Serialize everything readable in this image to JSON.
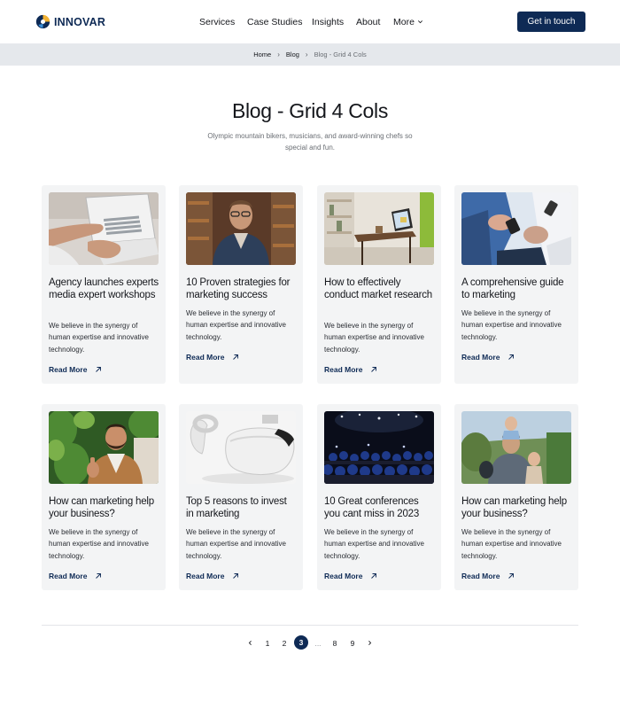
{
  "brand": {
    "name": "INNOVAR"
  },
  "nav": {
    "items": [
      "Services",
      "Case Studies",
      "Insights",
      "About"
    ],
    "more_label": "More"
  },
  "header": {
    "cta_label": "Get in touch"
  },
  "breadcrumb": {
    "home": "Home",
    "blog": "Blog",
    "current": "Blog - Grid 4 Cols"
  },
  "page": {
    "title": "Blog - Grid 4 Cols",
    "subtitle": "Olympic mountain bikers, musicians, and award-winning chefs so special and fun."
  },
  "posts": [
    {
      "title": "Agency launches experts media expert workshops",
      "excerpt": "We believe in the synergy of human expertise and innovative technology.",
      "link": "Read More",
      "image": "laptop-typing"
    },
    {
      "title": "10 Proven strategies for marketing success",
      "excerpt": "We believe in the synergy of human expertise and innovative technology.",
      "link": "Read More",
      "image": "man-with-glasses"
    },
    {
      "title": "How to effectively conduct market research",
      "excerpt": "We believe in the synergy of human expertise and innovative technology.",
      "link": "Read More",
      "image": "desk-with-laptop"
    },
    {
      "title": "A comprehensive guide to marketing",
      "excerpt": "We believe in the synergy of human expertise and innovative technology.",
      "link": "Read More",
      "image": "handshake-phones"
    },
    {
      "title": "How can marketing help your business?",
      "excerpt": "We believe in the synergy of human expertise and innovative technology.",
      "link": "Read More",
      "image": "bearded-man-thumbs-up"
    },
    {
      "title": "Top 5 reasons to invest in marketing",
      "excerpt": "We believe in the synergy of human expertise and innovative technology.",
      "link": "Read More",
      "image": "vr-headset"
    },
    {
      "title": "10 Great conferences you cant miss in 2023",
      "excerpt": "We believe in the synergy of human expertise and innovative technology.",
      "link": "Read More",
      "image": "conference-audience"
    },
    {
      "title": "How can marketing help your business?",
      "excerpt": "We believe in the synergy of human expertise and innovative technology.",
      "link": "Read More",
      "image": "family-outdoors"
    }
  ],
  "pagination": {
    "pages": [
      "1",
      "2",
      "3",
      "...",
      "8",
      "9"
    ],
    "current": "3"
  },
  "colors": {
    "brand_navy": "#0e2a55",
    "breadcrumb_bg": "#e5e8ec",
    "card_bg": "#f3f4f5"
  }
}
